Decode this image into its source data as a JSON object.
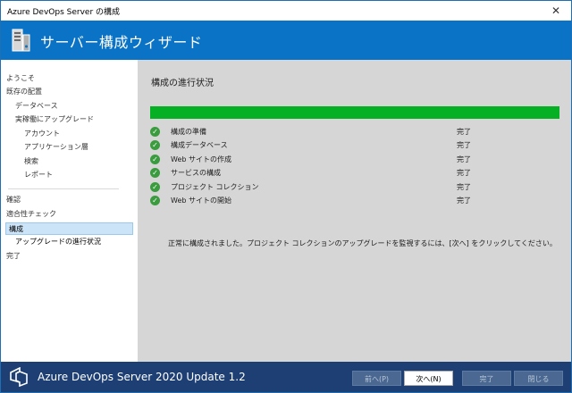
{
  "window": {
    "title": "Azure DevOps Server の構成",
    "close_glyph": "✕"
  },
  "banner": {
    "title": "サーバー構成ウィザード",
    "icon": "server-tower-icon"
  },
  "sidebar": {
    "items": [
      {
        "label": "ようこそ"
      },
      {
        "label": "既存の配置"
      },
      {
        "label": "データベース"
      },
      {
        "label": "実稼働にアップグレード"
      },
      {
        "label": "アカウント"
      },
      {
        "label": "アプリケーション層"
      },
      {
        "label": "検索"
      },
      {
        "label": "レポート"
      },
      {
        "label": "確認"
      },
      {
        "label": "適合性チェック"
      },
      {
        "label": "構成"
      },
      {
        "label": "アップグレードの進行状況"
      },
      {
        "label": "完了"
      }
    ]
  },
  "main": {
    "title": "構成の進行状況",
    "progress_percent": 100,
    "progress_color": "#06b025",
    "steps": [
      {
        "label": "構成の準備",
        "status": "完了"
      },
      {
        "label": "構成データベース",
        "status": "完了"
      },
      {
        "label": "Web サイトの作成",
        "status": "完了"
      },
      {
        "label": "サービスの構成",
        "status": "完了"
      },
      {
        "label": "プロジェクト コレクション",
        "status": "完了"
      },
      {
        "label": "Web サイトの開始",
        "status": "完了"
      }
    ],
    "message": "正常に構成されました。プロジェクト コレクションのアップグレードを監視するには、[次へ] をクリックしてください。"
  },
  "footer": {
    "product": "Azure DevOps Server 2020 Update 1.2",
    "buttons": {
      "prev": "前へ(P)",
      "next": "次へ(N)",
      "finish": "完了",
      "close": "閉じる"
    }
  },
  "colors": {
    "accent": "#0a73c6",
    "footer_bg": "#1d3f73",
    "check_green": "#3a9c3e"
  }
}
